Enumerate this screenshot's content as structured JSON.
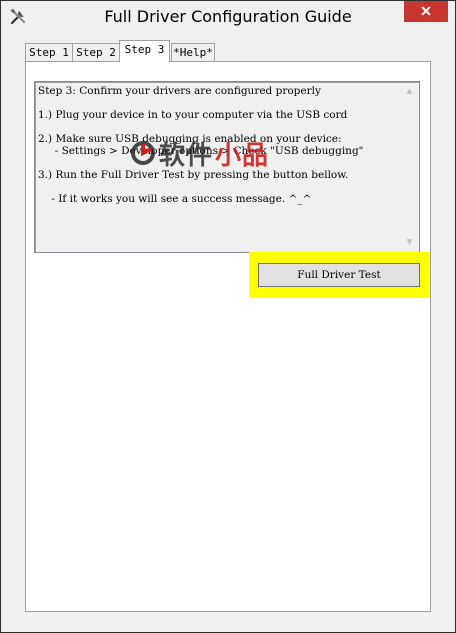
{
  "window": {
    "title": "Full Driver Configuration Guide",
    "close_symbol": "✕",
    "icon": "tools-icon"
  },
  "tabs": [
    {
      "label": "Step 1",
      "active": false
    },
    {
      "label": "Step 2",
      "active": false
    },
    {
      "label": "Step 3",
      "active": true
    },
    {
      "label": "*Help*",
      "active": false
    }
  ],
  "instructions": {
    "lines": [
      "Step 3: Confirm your drivers are configured properly",
      "",
      "1.) Plug your device in to your computer via the USB cord",
      "",
      "2.) Make sure USB debugging is enabled on your device:",
      "     - Settings > Developer options > Check \"USB debugging\"",
      "",
      "3.) Run the Full Driver Test by pressing the button bellow.",
      "",
      "    - If it works you will see a success message. ^_^"
    ]
  },
  "test_button": {
    "label": "Full Driver Test",
    "highlight_color": "#ffff00"
  },
  "watermark": {
    "text_a": "软件",
    "text_b": "小品",
    "icon": "watermark-logo-icon"
  },
  "colors": {
    "close": "#c7372f",
    "highlight": "#ffff00"
  }
}
